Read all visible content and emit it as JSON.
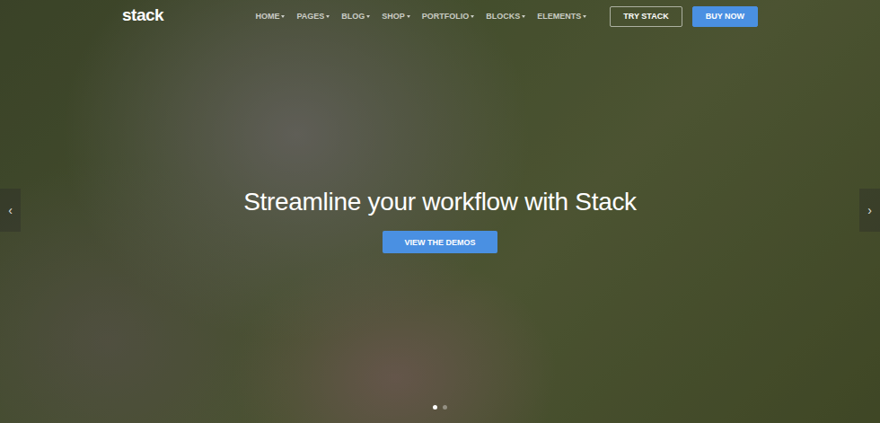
{
  "logo": "stack",
  "nav": [
    {
      "label": "HOME"
    },
    {
      "label": "PAGES"
    },
    {
      "label": "BLOG"
    },
    {
      "label": "SHOP"
    },
    {
      "label": "PORTFOLIO"
    },
    {
      "label": "BLOCKS"
    },
    {
      "label": "ELEMENTS"
    }
  ],
  "actions": [
    {
      "label": "TRY STACK",
      "kind": "outline"
    },
    {
      "label": "BUY NOW",
      "kind": "solid"
    }
  ],
  "hero": {
    "headline": "Streamline your workflow with Stack",
    "button": "VIEW THE DEMOS"
  },
  "slider": {
    "prev": "‹",
    "next": "›",
    "dots": [
      {
        "selected": true
      },
      {
        "selected": false
      }
    ]
  }
}
